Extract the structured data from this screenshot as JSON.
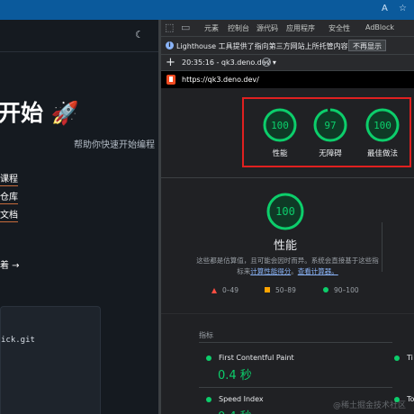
{
  "browser": {
    "reader_icon": "A",
    "favorite_icon": "☆"
  },
  "page": {
    "hero_title": "开始 🚀",
    "hero_subtitle": "帮助你快速开始编程",
    "links": [
      "课程",
      "仓库",
      "文档"
    ],
    "more_link": "着 →",
    "code_text": "ick.git",
    "theme_icon": "moon-icon"
  },
  "devtools": {
    "tabs": [
      "元素",
      "控制台",
      "源代码",
      "应用程序",
      "安全性",
      "AdBlock"
    ],
    "info": {
      "message": "Lighthouse 工具提供了指向第三方网站上所托管内容的链接。",
      "button": "不再显示"
    },
    "report_select": "20:35:16 - qk3.deno.dev ▾",
    "url": "https://qk3.deno.dev/",
    "scores": [
      {
        "value": "100",
        "label": "性能",
        "score": 1.0
      },
      {
        "value": "97",
        "label": "无障碍",
        "score": 0.97
      },
      {
        "value": "100",
        "label": "最佳做法",
        "score": 1.0
      }
    ],
    "main_score": {
      "value": "100",
      "label": "性能",
      "score": 1.0
    },
    "description": {
      "line1": "这些都是估算值，且可能会因时而异。系统会直接基于这些指",
      "line2_prefix": "标来",
      "link1": "计算性能得分",
      "line2_mid": "。",
      "link2": "查看计算器。"
    },
    "legend": [
      {
        "range": "0–49"
      },
      {
        "range": "50–89"
      },
      {
        "range": "90–100"
      }
    ],
    "metrics_heading": "指标",
    "metrics": [
      {
        "name": "First Contentful Paint",
        "value": "0.4 秒"
      },
      {
        "name": "Speed Index",
        "value": "0.4 秒"
      }
    ],
    "metrics_right": [
      "Ti",
      "To"
    ]
  },
  "colors": {
    "pass": "#0cce6b",
    "average": "#ffa400",
    "fail": "#ff4e42",
    "highlight_box": "#e02020"
  },
  "watermark": "@稀土掘金技术社区"
}
